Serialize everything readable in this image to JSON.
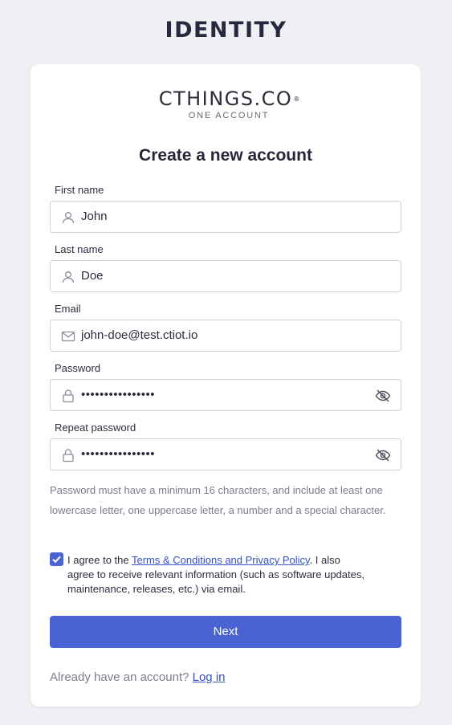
{
  "app": {
    "title": "IDENTITY"
  },
  "logo": {
    "word": "CTHINGS.CO",
    "reg": "®",
    "sub": "ONE ACCOUNT"
  },
  "form": {
    "title": "Create a new account",
    "first_name": {
      "label": "First name",
      "value": "John",
      "icon": "user-icon"
    },
    "last_name": {
      "label": "Last name",
      "value": "Doe",
      "icon": "user-icon"
    },
    "email": {
      "label": "Email",
      "value": "john-doe@test.ctiot.io",
      "icon": "mail-icon"
    },
    "password": {
      "label": "Password",
      "value": "••••••••••••••••",
      "icon": "lock-icon",
      "toggle_icon": "eye-off-icon"
    },
    "repeat_password": {
      "label": "Repeat password",
      "value": "••••••••••••••••",
      "icon": "lock-icon",
      "toggle_icon": "eye-off-icon"
    },
    "hint": "Password must have a minimum 16 characters, and include at least one lowercase letter, one uppercase letter, a number and a special character.",
    "agree": {
      "checked": true,
      "prefix": "I agree to the ",
      "link": "Terms & Conditions and Privacy Policy",
      "suffix": ". I also agree to receive relevant information (such as software updates, maintenance, releases, etc.) via email."
    },
    "next_label": "Next",
    "footer": {
      "text": "Already have an account? ",
      "link": "Log in"
    }
  },
  "colors": {
    "accent": "#4a63d3",
    "background": "#f0f0f4",
    "card": "#ffffff"
  }
}
